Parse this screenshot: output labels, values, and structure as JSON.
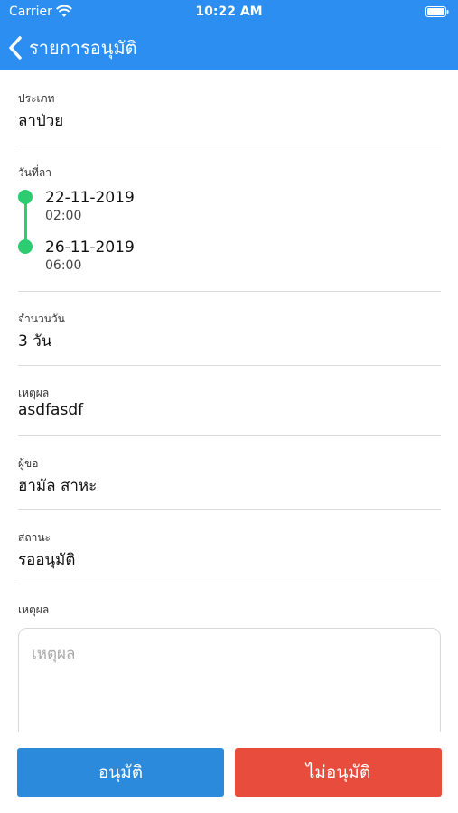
{
  "status_bar": {
    "carrier": "Carrier",
    "time": "10:22 AM"
  },
  "nav": {
    "title": "รายการอนุมัติ"
  },
  "fields": {
    "type": {
      "label": "ประเภท",
      "value": "ลาป่วย"
    },
    "leave_dates": {
      "label": "วันที่ลา",
      "start_date": "22-11-2019",
      "start_time": "02:00",
      "end_date": "26-11-2019",
      "end_time": "06:00"
    },
    "days": {
      "label": "จำนวนวัน",
      "value": "3 วัน"
    },
    "reason": {
      "label": "เหตุผล",
      "value": "asdfasdf"
    },
    "requester": {
      "label": "ผู้ขอ",
      "value": "ฮามัล สาหะ"
    },
    "status": {
      "label": "สถานะ",
      "value": "รออนุมัติ"
    },
    "approver_reason": {
      "label": "เหตุผล",
      "placeholder": "เหตุผล"
    }
  },
  "actions": {
    "approve_label": "อนุมัติ",
    "reject_label": "ไม่อนุมัติ"
  },
  "colors": {
    "primary": "#2b8ef0",
    "approve": "#2b8adb",
    "reject": "#e74c3c",
    "timeline": "#2ecc71"
  }
}
